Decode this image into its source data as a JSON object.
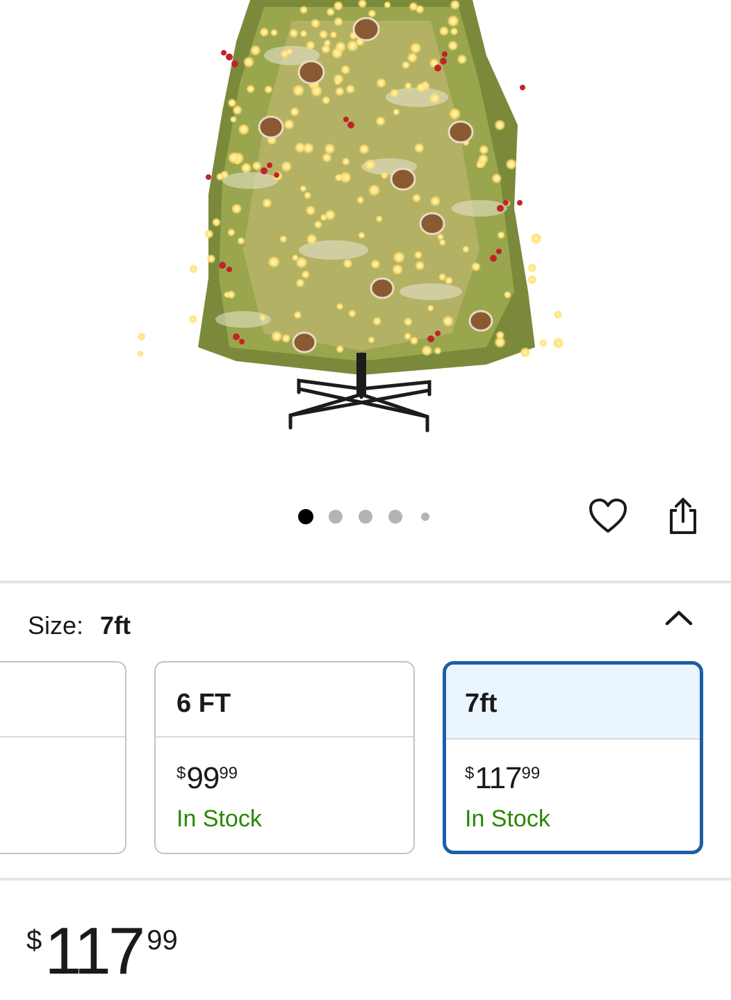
{
  "product_image": {
    "alt_icon": "christmas-tree-image"
  },
  "carousel": {
    "total": 5,
    "active": 0
  },
  "actions": {
    "favorite_icon": "heart-icon",
    "share_icon": "share-icon"
  },
  "size_selector": {
    "label": "Size:",
    "selected": "7ft",
    "toggle_icon": "chevron-up-icon",
    "options": [
      {
        "name": "6 FT",
        "price_currency": "$",
        "price_dollars": "99",
        "price_cents": "99",
        "stock": "In Stock"
      },
      {
        "name": "7ft",
        "price_currency": "$",
        "price_dollars": "117",
        "price_cents": "99",
        "stock": "In Stock"
      }
    ]
  },
  "price": {
    "currency": "$",
    "dollars": "117",
    "cents": "99"
  },
  "colors": {
    "selected_border": "#1b5ea6",
    "selected_fill": "#eaf5fe",
    "in_stock": "#2a8703"
  }
}
